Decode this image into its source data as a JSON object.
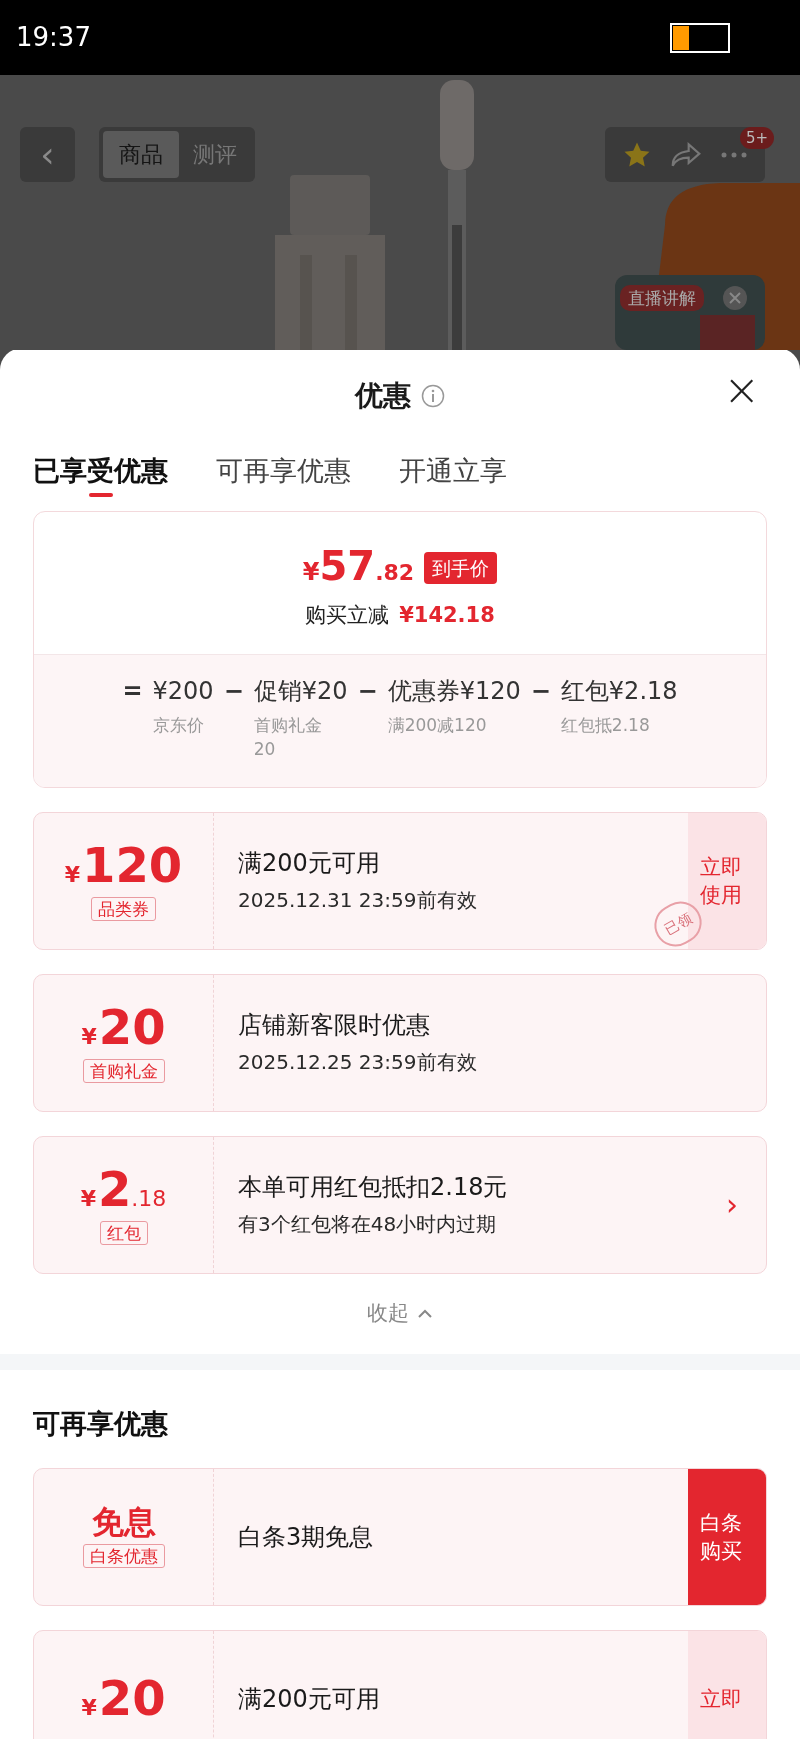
{
  "status_bar": {
    "time": "19:37"
  },
  "product_page": {
    "back": "‹",
    "tabs": [
      {
        "label": "商品",
        "selected": true
      },
      {
        "label": "测评",
        "selected": false
      }
    ],
    "badge": "5+",
    "live": "直播讲解"
  },
  "sheet": {
    "title": "优惠",
    "close": "×",
    "tabs": [
      {
        "label": "已享受优惠",
        "selected": true
      },
      {
        "label": "可再享优惠",
        "selected": false
      },
      {
        "label": "开通立享",
        "selected": false
      }
    ],
    "summary": {
      "currency": "¥",
      "price_int": "57",
      "price_dec": ".82",
      "price_tag": "到手价",
      "saving_label": "购买立减",
      "saving": "¥142.18",
      "formula": [
        {
          "op": "=",
          "amount": "¥200",
          "note": "京东价"
        },
        {
          "op": "−",
          "name": "促销",
          "amount": "¥20",
          "note": "首购礼金20"
        },
        {
          "op": "−",
          "name": "优惠券",
          "amount": "¥120",
          "note": "满200减120"
        },
        {
          "op": "−",
          "name": "红包",
          "amount": "¥2.18",
          "note": "红包抵2.18"
        }
      ]
    },
    "coupons": [
      {
        "currency": "¥",
        "amount": "120",
        "tag": "品类券",
        "title": "满200元可用",
        "subtitle": "2025.12.31 23:59前有效",
        "action": {
          "kind": "light",
          "label": "立即使用"
        },
        "stamp": "已领"
      },
      {
        "currency": "¥",
        "amount": "20",
        "tag": "首购礼金",
        "title": "店铺新客限时优惠",
        "subtitle": "2025.12.25 23:59前有效"
      },
      {
        "currency": "¥",
        "amount": "2",
        "decimal": ".18",
        "tag": "红包",
        "title": "本单可用红包抵扣2.18元",
        "subtitle": "有3个红包将在48小时内过期",
        "action": {
          "kind": "arrow",
          "label": "›"
        }
      }
    ],
    "collapse": "收起",
    "more_title": "可再享优惠",
    "more_coupons": [
      {
        "headline": "免息",
        "tag": "白条优惠",
        "title": "白条3期免息",
        "action": {
          "kind": "solid",
          "label": "白条购买"
        }
      },
      {
        "currency": "¥",
        "amount": "20",
        "title": "满200元可用",
        "action": {
          "kind": "light",
          "label": "立即"
        }
      }
    ]
  }
}
